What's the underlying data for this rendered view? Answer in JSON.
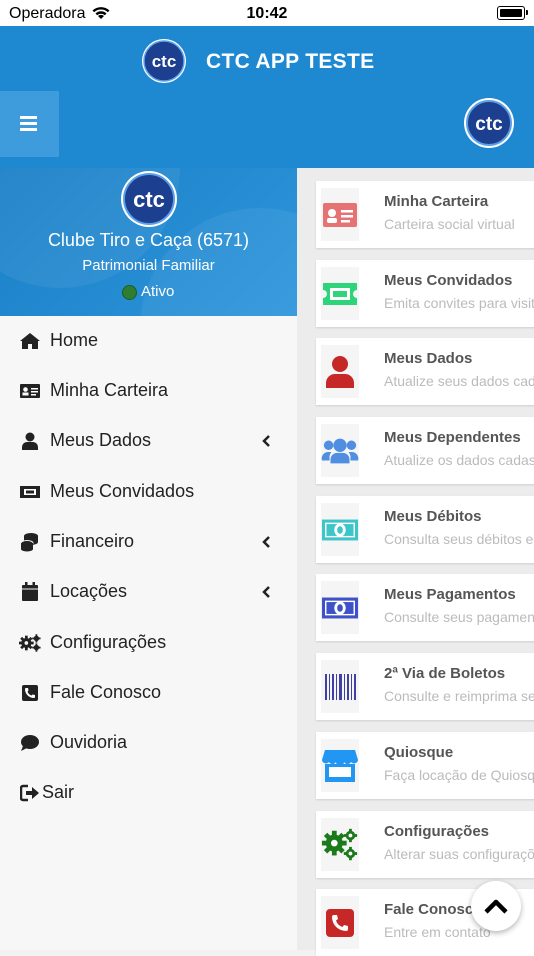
{
  "status_bar": {
    "carrier": "Operadora",
    "time": "10:42"
  },
  "header": {
    "title": "CTC APP TESTE",
    "logo_text": "ctc"
  },
  "drawer": {
    "logo_text": "ctc",
    "member_name": "Clube Tiro e Caça (6571)",
    "member_type": "Patrimonial Familiar",
    "status": "Ativo",
    "items": [
      {
        "label": "Home",
        "icon": "home-icon"
      },
      {
        "label": "Minha Carteira",
        "icon": "id-card-icon"
      },
      {
        "label": "Meus Dados",
        "icon": "user-icon",
        "has_submenu": true
      },
      {
        "label": "Meus Convidados",
        "icon": "ticket-icon"
      },
      {
        "label": "Financeiro",
        "icon": "coins-icon",
        "has_submenu": true
      },
      {
        "label": "Locações",
        "icon": "calendar-icon",
        "has_submenu": true
      },
      {
        "label": "Configurações",
        "icon": "gears-icon"
      },
      {
        "label": "Fale Conosco",
        "icon": "phone-icon"
      },
      {
        "label": "Ouvidoria",
        "icon": "comment-icon"
      },
      {
        "label": "Sair",
        "icon": "sign-out-icon"
      }
    ]
  },
  "cards": [
    {
      "title": "Minha Carteira",
      "subtitle": "Carteira social virtual",
      "icon": "id-card-icon",
      "color": "#e57373"
    },
    {
      "title": "Meus Convidados",
      "subtitle": "Emita convites para visita",
      "icon": "ticket-icon",
      "color": "#2ed47a"
    },
    {
      "title": "Meus Dados",
      "subtitle": "Atualize seus dados cad",
      "icon": "user-icon",
      "color": "#c62828"
    },
    {
      "title": "Meus Dependentes",
      "subtitle": "Atualize os dados cadas",
      "icon": "users-icon",
      "color": "#4f8ee0"
    },
    {
      "title": "Meus Débitos",
      "subtitle": "Consulta seus débitos e",
      "icon": "money-icon",
      "color": "#3ec5c8"
    },
    {
      "title": "Meus Pagamentos",
      "subtitle": "Consulte seus pagamen",
      "icon": "money-icon",
      "color": "#3f51c8"
    },
    {
      "title": "2ª Via de Boletos",
      "subtitle": "Consulte e reimprima se",
      "icon": "barcode-icon",
      "color": "#3f3fa8"
    },
    {
      "title": "Quiosque",
      "subtitle": "Faça locação de Quiosq",
      "icon": "store-icon",
      "color": "#2196f3"
    },
    {
      "title": "Configurações",
      "subtitle": "Alterar suas configuraçõ",
      "icon": "gears-icon",
      "color": "#1b7a1b"
    },
    {
      "title": "Fale Conosco",
      "subtitle": "Entre em contato",
      "icon": "phone-icon",
      "color": "#c62828"
    }
  ],
  "colors": {
    "primary": "#1e88d0",
    "active": "#2e7d32"
  }
}
